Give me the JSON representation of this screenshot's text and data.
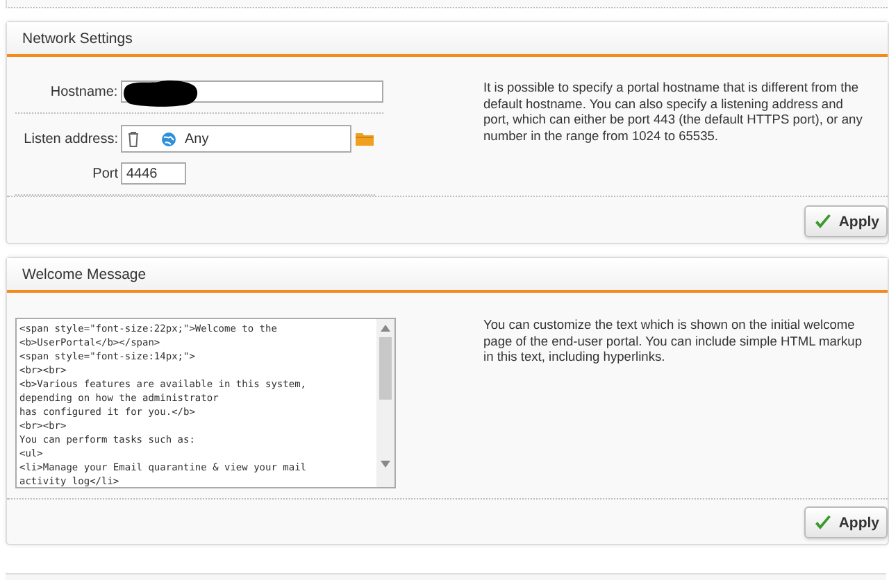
{
  "panels": [
    {
      "kind": "network",
      "title": "Network Settings",
      "fields": [
        {
          "kind": "text",
          "label": "Hostname:",
          "redacted": true,
          "wide": true
        },
        {
          "kind": "address",
          "label": "Listen address:",
          "value": "Any"
        },
        {
          "kind": "text",
          "label": "Port",
          "value": "4446",
          "wide": false
        }
      ],
      "description": [
        "It is possible to specify a portal hostname that is different from the",
        "default hostname. You can also specify a listening address and",
        "port, which can either be port 443 (the default HTTPS port), or any",
        "number in the range from 1024 to 65535."
      ],
      "button": "Apply"
    },
    {
      "kind": "message",
      "title": "Welcome Message",
      "editor_lines": [
        "<span style=\"font-size:22px;\">Welcome to the",
        "<b>UserPortal</b></span>",
        "<span style=\"font-size:14px;\">",
        "<br><br>",
        "<b>Various features are available in this system,",
        "depending on how the administrator",
        "has configured it for you.</b>",
        "<br><br>",
        "You can perform tasks such as:",
        "<ul>",
        "<li>Manage your Email quarantine & view your mail",
        "activity log</li>"
      ],
      "description": [
        "You can customize the text which is shown on the initial welcome",
        "page of the end-user portal. You can include simple HTML markup",
        "in this text, including hyperlinks."
      ],
      "button": "Apply"
    }
  ]
}
